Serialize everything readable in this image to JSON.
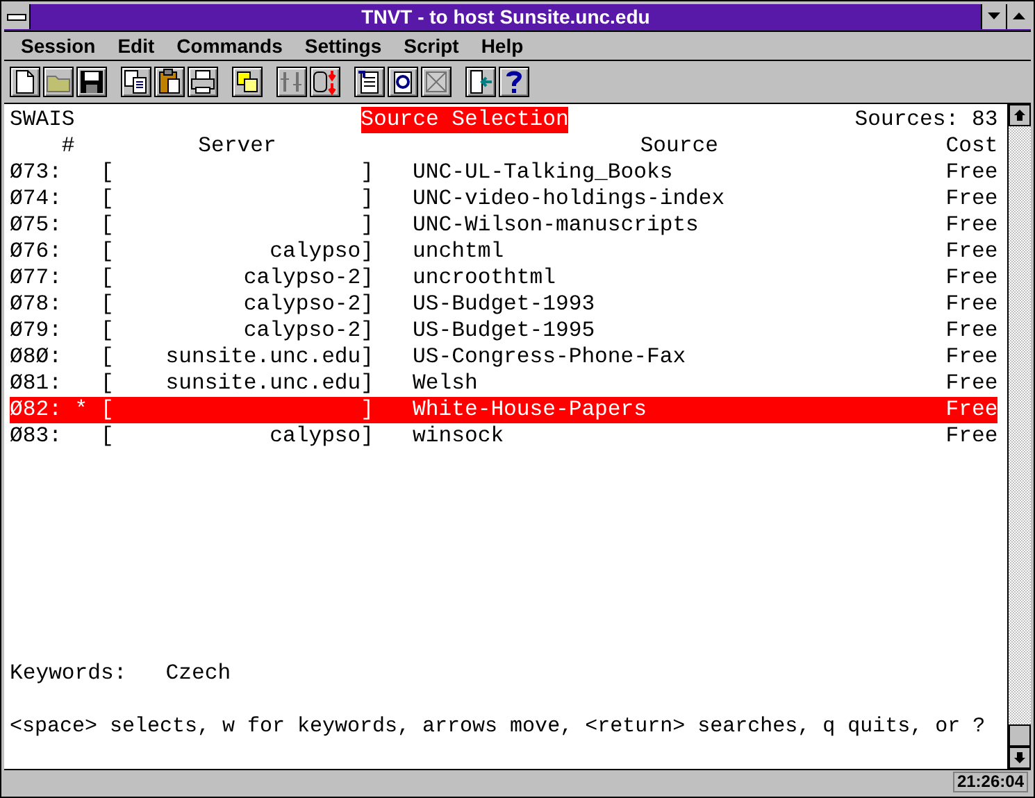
{
  "window": {
    "title": "TNVT - to host Sunsite.unc.edu"
  },
  "menu": [
    "Session",
    "Edit",
    "Commands",
    "Settings",
    "Script",
    "Help"
  ],
  "toolbar": [
    [
      {
        "kind": "new",
        "disabled": false
      },
      {
        "kind": "open",
        "disabled": true
      },
      {
        "kind": "save",
        "disabled": false
      }
    ],
    [
      {
        "kind": "copy",
        "disabled": false
      },
      {
        "kind": "paste",
        "disabled": false
      },
      {
        "kind": "print",
        "disabled": false
      }
    ],
    [
      {
        "kind": "windows",
        "disabled": false
      }
    ],
    [
      {
        "kind": "split",
        "disabled": true
      },
      {
        "kind": "transfer",
        "disabled": false
      }
    ],
    [
      {
        "kind": "script",
        "disabled": false
      },
      {
        "kind": "refresh",
        "disabled": false
      },
      {
        "kind": "stop",
        "disabled": true
      }
    ],
    [
      {
        "kind": "exit",
        "disabled": false
      },
      {
        "kind": "help",
        "disabled": false
      }
    ]
  ],
  "terminal": {
    "app": "SWAIS",
    "title": "Source Selection",
    "sources": "Sources: 83",
    "columns": [
      "#",
      "Server",
      "Source",
      "Cost"
    ],
    "rows": [
      {
        "num": "Ø73:",
        "server": "[                   ]",
        "source": "UNC-UL-Talking_Books",
        "cost": "Free",
        "selected": false
      },
      {
        "num": "Ø74:",
        "server": "[                   ]",
        "source": "UNC-video-holdings-index",
        "cost": "Free",
        "selected": false
      },
      {
        "num": "Ø75:",
        "server": "[                   ]",
        "source": "UNC-Wilson-manuscripts",
        "cost": "Free",
        "selected": false
      },
      {
        "num": "Ø76:",
        "server": "[            calypso]",
        "source": "unchtml",
        "cost": "Free",
        "selected": false
      },
      {
        "num": "Ø77:",
        "server": "[          calypso-2]",
        "source": "uncroothtml",
        "cost": "Free",
        "selected": false
      },
      {
        "num": "Ø78:",
        "server": "[          calypso-2]",
        "source": "US-Budget-1993",
        "cost": "Free",
        "selected": false
      },
      {
        "num": "Ø79:",
        "server": "[          calypso-2]",
        "source": "US-Budget-1995",
        "cost": "Free",
        "selected": false
      },
      {
        "num": "Ø8Ø:",
        "server": "[    sunsite.unc.edu]",
        "source": "US-Congress-Phone-Fax",
        "cost": "Free",
        "selected": false
      },
      {
        "num": "Ø81:",
        "server": "[    sunsite.unc.edu]",
        "source": "Welsh",
        "cost": "Free",
        "selected": false
      },
      {
        "num": "Ø82:",
        "marker": "*",
        "server": "[                   ]",
        "source": "White-House-Papers",
        "cost": "Free",
        "selected": true
      },
      {
        "num": "Ø83:",
        "server": "[            calypso]",
        "source": "winsock",
        "cost": "Free",
        "selected": false
      }
    ],
    "keywords_label": "Keywords:",
    "keywords": "Czech",
    "help": "<space> selects, w for keywords, arrows move, <return> searches, q quits, or ?"
  },
  "status_bar": {
    "time": "21:26:04"
  }
}
